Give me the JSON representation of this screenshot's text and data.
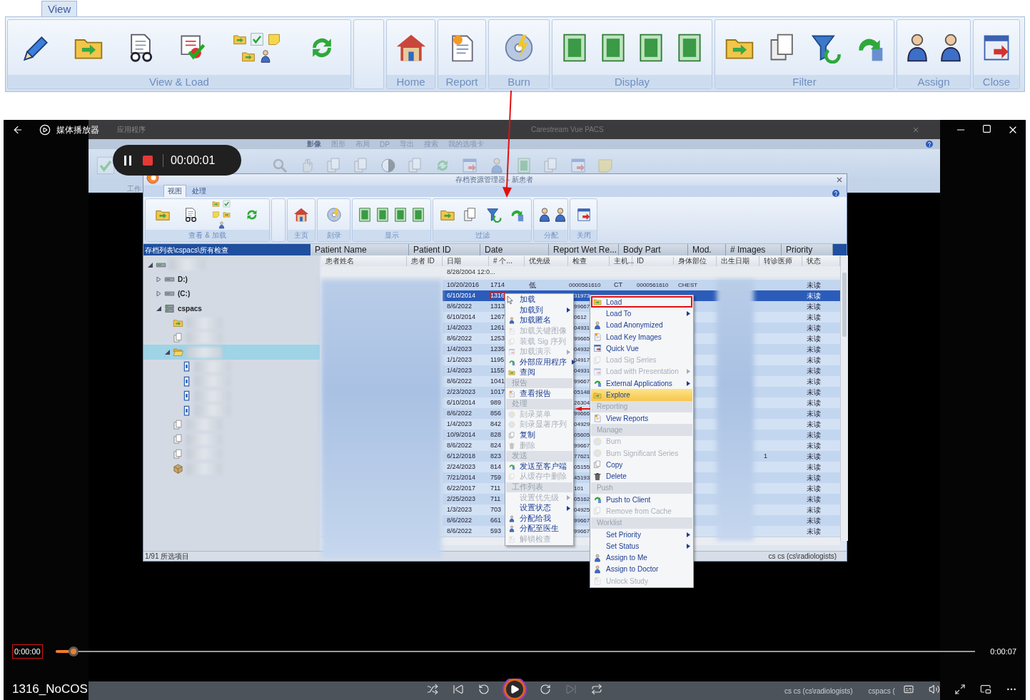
{
  "top_ribbon": {
    "tab": {
      "label": "View",
      "selected": true
    },
    "groups": [
      "View & Load",
      "Home",
      "Report",
      "Burn",
      "Display",
      "Filter",
      "Assign",
      "Close"
    ]
  },
  "player": {
    "title": "媒体播放器",
    "recording_time": "00:00:01",
    "current_time": "0:00:00",
    "current_time_marked": true,
    "total_time": "0:00:07",
    "level": 0.02,
    "file_name": "1316_NoCOS"
  },
  "pacs": {
    "menu": "应用程序",
    "title": "Carestream Vue PACS",
    "tabs": [
      {
        "label": "影像",
        "selected": true
      },
      {
        "label": "图形",
        "selected": false
      },
      {
        "label": "布局",
        "selected": false
      },
      {
        "label": "DP",
        "selected": false
      },
      {
        "label": "导出",
        "selected": false
      },
      {
        "label": "搜索",
        "selected": false
      },
      {
        "label": "我的选项卡",
        "selected": false
      }
    ],
    "group_label": "工作",
    "taskbar": [
      "cs cs (cs\\radiologists)",
      "cspacs ("
    ]
  },
  "dialog": {
    "title": "存档资源管理器 - 新患者",
    "tabs": [
      {
        "label": "视图",
        "selected": true
      },
      {
        "label": "处理",
        "selected": false
      }
    ],
    "groups": [
      "查看 & 加载",
      "主页",
      "刻录",
      "显示",
      "过滤",
      "分配",
      "关闭"
    ],
    "path": "存档列表\\cspacs\\所有检查",
    "header_columns": [
      "Patient Name",
      "Patient ID",
      "Date",
      "Report Wet Re...",
      "Body Part",
      "Mod.",
      "# Images",
      "Priority"
    ],
    "tree": [
      {
        "kind": "drive",
        "expanded": true,
        "selected": false,
        "children": [
          {
            "kind": "drive",
            "label": "D:)",
            "expanded": false,
            "selected": false
          },
          {
            "kind": "drive",
            "label": "(C:)",
            "expanded": false,
            "selected": false
          },
          {
            "kind": "server",
            "label": "cspacs",
            "expanded": true,
            "selected": false,
            "children": [
              {
                "kind": "study",
                "selected": false
              },
              {
                "kind": "report",
                "selected": false
              },
              {
                "kind": "folder",
                "expanded": true,
                "selected": true,
                "children": [
                  {
                    "kind": "series",
                    "selected": false
                  },
                  {
                    "kind": "series",
                    "selected": false
                  },
                  {
                    "kind": "series",
                    "selected": false
                  },
                  {
                    "kind": "series",
                    "selected": false
                  }
                ]
              },
              {
                "kind": "report",
                "selected": false
              },
              {
                "kind": "report",
                "selected": false
              },
              {
                "kind": "report",
                "selected": false
              },
              {
                "kind": "storage",
                "selected": false
              }
            ]
          }
        ]
      }
    ],
    "columns": [
      "患者姓名",
      "患者 ID",
      "日期",
      "# 个...",
      "优先级",
      "检查",
      "主机...",
      "ID",
      "身体部位",
      "出生日期",
      "转诊医师",
      "状态"
    ],
    "filter_date": "8/28/2004 12:0...",
    "rows": [
      {
        "date": "10/20/2016",
        "count": "1714",
        "priority": "低",
        "check": "0000561610",
        "modality": "CT",
        "id": "0000561610",
        "body_part": "CHEST",
        "status": "未读",
        "selected": false,
        "marked": false
      },
      {
        "date": "6/10/2014",
        "count": "1316",
        "check": "31973",
        "status": "未读",
        "selected": true,
        "marked": true
      },
      {
        "date": "8/6/2022",
        "count": "1313",
        "check": "99667",
        "status": "未读",
        "selected": false,
        "marked": false
      },
      {
        "date": "6/10/2014",
        "count": "1267",
        "check": "0612",
        "status": "未读",
        "selected": false,
        "marked": false
      },
      {
        "date": "1/4/2023",
        "count": "1261",
        "check": "04931",
        "status": "未读",
        "selected": false,
        "marked": false
      },
      {
        "date": "8/6/2022",
        "count": "1253",
        "check": "99665",
        "status": "未读",
        "selected": false,
        "marked": false
      },
      {
        "date": "1/4/2023",
        "count": "1235",
        "check": "04932",
        "status": "未读",
        "selected": false,
        "marked": false
      },
      {
        "date": "1/1/2023",
        "count": "1195",
        "check": "04917",
        "status": "未读",
        "selected": false,
        "marked": false
      },
      {
        "date": "1/4/2023",
        "count": "1155",
        "check": "04931",
        "status": "未读",
        "selected": false,
        "marked": false
      },
      {
        "date": "8/6/2022",
        "count": "1041",
        "check": "99667",
        "status": "未读",
        "selected": false,
        "marked": false
      },
      {
        "date": "2/23/2023",
        "count": "1017",
        "check": "05148",
        "status": "未读",
        "selected": false,
        "marked": false
      },
      {
        "date": "6/10/2014",
        "count": "989",
        "check": "26304",
        "status": "未读",
        "selected": false,
        "marked": false
      },
      {
        "date": "8/6/2022",
        "count": "856",
        "check": "99666",
        "status": "未读",
        "selected": false,
        "marked": false
      },
      {
        "date": "1/4/2023",
        "count": "842",
        "check": "04929",
        "status": "未读",
        "selected": false,
        "marked": false
      },
      {
        "date": "10/9/2014",
        "count": "828",
        "check": "05605",
        "status": "未读",
        "selected": false,
        "marked": false
      },
      {
        "date": "8/6/2022",
        "count": "824",
        "check": "99667",
        "status": "未读",
        "selected": false,
        "marked": false
      },
      {
        "date": "6/12/2018",
        "count": "823",
        "check": "77621",
        "referral": "1",
        "status": "未读",
        "selected": false,
        "marked": false
      },
      {
        "date": "2/24/2023",
        "count": "814",
        "check": "05155",
        "status": "未读",
        "selected": false,
        "marked": false
      },
      {
        "date": "7/21/2014",
        "count": "759",
        "check": "45193",
        "status": "未读",
        "selected": false,
        "marked": false
      },
      {
        "date": "6/22/2017",
        "count": "711",
        "check": "101",
        "status": "未读",
        "selected": false,
        "marked": false
      },
      {
        "date": "2/25/2023",
        "count": "711",
        "check": "05162",
        "status": "未读",
        "selected": false,
        "marked": false
      },
      {
        "date": "1/3/2023",
        "count": "703",
        "check": "04925",
        "status": "未读",
        "selected": false,
        "marked": false
      },
      {
        "date": "8/6/2022",
        "count": "661",
        "check": "99667",
        "status": "未读",
        "selected": false,
        "marked": false
      },
      {
        "date": "8/6/2022",
        "count": "593",
        "check": "99667",
        "status": "未读",
        "selected": false,
        "marked": false
      }
    ],
    "status_left": "1/91 所选项目",
    "status_right": "cs cs (cs\\radiologists)",
    "menu_zh": [
      {
        "kind": "item",
        "label": "加载",
        "disabled": false,
        "submenu": false
      },
      {
        "kind": "item",
        "label": "加载到",
        "disabled": false,
        "submenu": true
      },
      {
        "kind": "item",
        "label": "加载匿名",
        "disabled": false,
        "submenu": false
      },
      {
        "kind": "item",
        "label": "加载关键图像",
        "disabled": true,
        "submenu": false
      },
      {
        "kind": "item",
        "label": "装载 Sig 序列",
        "disabled": true,
        "submenu": false
      },
      {
        "kind": "item",
        "label": "加载演示",
        "disabled": true,
        "submenu": true
      },
      {
        "kind": "item",
        "label": "外部应用程序",
        "disabled": false,
        "submenu": true
      },
      {
        "kind": "item",
        "label": "查阅",
        "disabled": false,
        "submenu": false
      },
      {
        "kind": "header",
        "label": "报告"
      },
      {
        "kind": "item",
        "label": "查看报告",
        "disabled": false,
        "submenu": false
      },
      {
        "kind": "header",
        "label": "处理"
      },
      {
        "kind": "item",
        "label": "刻录菜单",
        "disabled": true,
        "submenu": false
      },
      {
        "kind": "item",
        "label": "刻录显著序列",
        "disabled": true,
        "submenu": false
      },
      {
        "kind": "item",
        "label": "复制",
        "disabled": false,
        "submenu": false
      },
      {
        "kind": "item",
        "label": "删除",
        "disabled": true,
        "submenu": false
      },
      {
        "kind": "header",
        "label": "发送"
      },
      {
        "kind": "item",
        "label": "发送至客户端",
        "disabled": false,
        "submenu": false
      },
      {
        "kind": "item",
        "label": "从缓存中删除",
        "disabled": true,
        "submenu": false
      },
      {
        "kind": "header",
        "label": "工作列表"
      },
      {
        "kind": "item",
        "label": "设置优先级",
        "disabled": true,
        "submenu": true
      },
      {
        "kind": "item",
        "label": "设置状态",
        "disabled": false,
        "submenu": true
      },
      {
        "kind": "item",
        "label": "分配给我",
        "disabled": false,
        "submenu": false
      },
      {
        "kind": "item",
        "label": "分配至医生",
        "disabled": false,
        "submenu": false
      },
      {
        "kind": "item",
        "label": "解锁检查",
        "disabled": true,
        "submenu": false
      }
    ],
    "menu_en": [
      {
        "kind": "item",
        "label": "Load",
        "disabled": false,
        "submenu": false,
        "marked": true,
        "hovered": false
      },
      {
        "kind": "item",
        "label": "Load To",
        "disabled": false,
        "submenu": true,
        "marked": false,
        "hovered": false
      },
      {
        "kind": "item",
        "label": "Load Anonymized",
        "disabled": false,
        "submenu": false,
        "marked": false,
        "hovered": false
      },
      {
        "kind": "item",
        "label": "Load Key Images",
        "disabled": false,
        "submenu": false,
        "marked": false,
        "hovered": false
      },
      {
        "kind": "item",
        "label": "Quick Vue",
        "disabled": false,
        "submenu": false,
        "marked": false,
        "hovered": false
      },
      {
        "kind": "item",
        "label": "Load Sig Series",
        "disabled": true,
        "submenu": false,
        "marked": false,
        "hovered": false
      },
      {
        "kind": "item",
        "label": "Load with Presentation",
        "disabled": true,
        "submenu": true,
        "marked": false,
        "hovered": false
      },
      {
        "kind": "item",
        "label": "External Applications",
        "disabled": false,
        "submenu": true,
        "marked": false,
        "hovered": false
      },
      {
        "kind": "item",
        "label": "Explore",
        "disabled": false,
        "submenu": false,
        "marked": false,
        "hovered": true
      },
      {
        "kind": "header",
        "label": "Reporting"
      },
      {
        "kind": "item",
        "label": "View Reports",
        "disabled": false,
        "submenu": false,
        "marked": false,
        "hovered": false
      },
      {
        "kind": "header",
        "label": "Manage"
      },
      {
        "kind": "item",
        "label": "Burn",
        "disabled": true,
        "submenu": false,
        "marked": false,
        "hovered": false
      },
      {
        "kind": "item",
        "label": "Burn Significant Series",
        "disabled": true,
        "submenu": false,
        "marked": false,
        "hovered": false
      },
      {
        "kind": "item",
        "label": "Copy",
        "disabled": false,
        "submenu": false,
        "marked": false,
        "hovered": false
      },
      {
        "kind": "item",
        "label": "Delete",
        "disabled": false,
        "submenu": false,
        "marked": false,
        "hovered": false
      },
      {
        "kind": "header",
        "label": "Push"
      },
      {
        "kind": "item",
        "label": "Push to Client",
        "disabled": false,
        "submenu": false,
        "marked": false,
        "hovered": false
      },
      {
        "kind": "item",
        "label": "Remove from Cache",
        "disabled": true,
        "submenu": false,
        "marked": false,
        "hovered": false
      },
      {
        "kind": "header",
        "label": "Worklist"
      },
      {
        "kind": "item",
        "label": "Set Priority",
        "disabled": false,
        "submenu": true,
        "marked": false,
        "hovered": false
      },
      {
        "kind": "item",
        "label": "Set Status",
        "disabled": false,
        "submenu": true,
        "marked": false,
        "hovered": false
      },
      {
        "kind": "item",
        "label": "Assign to Me",
        "disabled": false,
        "submenu": false,
        "marked": false,
        "hovered": false
      },
      {
        "kind": "item",
        "label": "Assign to Doctor",
        "disabled": false,
        "submenu": false,
        "marked": false,
        "hovered": false
      },
      {
        "kind": "item",
        "label": "Unlock Study",
        "disabled": true,
        "submenu": false,
        "marked": false,
        "hovered": false
      }
    ]
  }
}
